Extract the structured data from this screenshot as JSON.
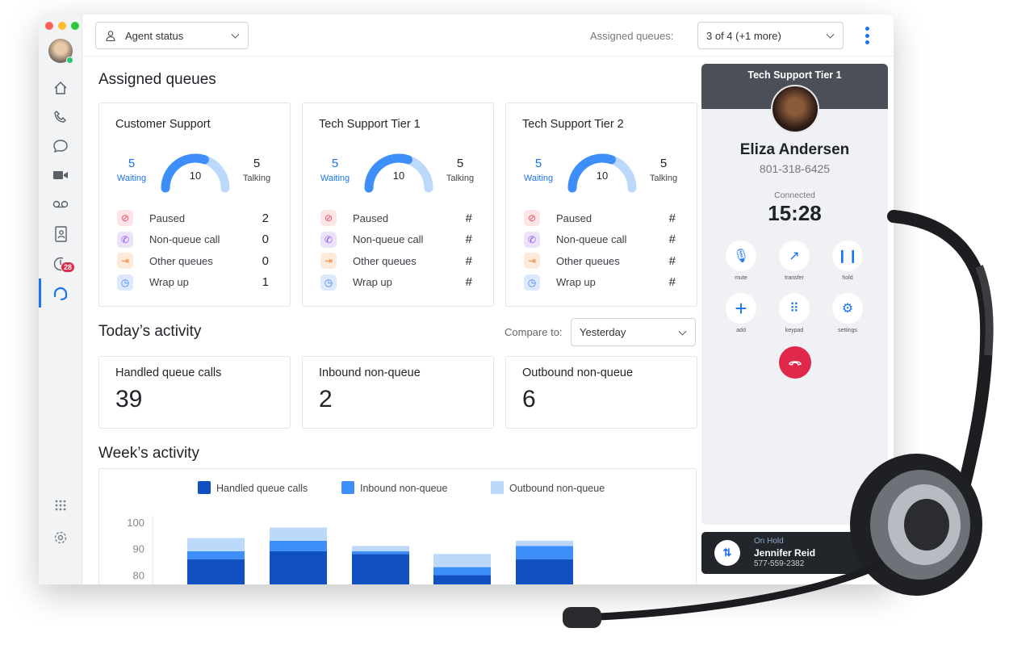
{
  "topbar": {
    "agent_status": "Agent status",
    "assigned_label": "Assigned queues:",
    "assigned_value": "3 of 4 (+1 more)"
  },
  "sidebar": {
    "badge": "28",
    "items": [
      "home",
      "phone",
      "chat",
      "video",
      "voicemail",
      "contacts",
      "history",
      "queues"
    ]
  },
  "assigned": {
    "title": "Assigned queues",
    "queues": [
      {
        "name": "Customer Support",
        "waiting": "5",
        "waiting_label": "Waiting",
        "total": "10",
        "talking": "5",
        "talking_label": "Talking",
        "gauge_fill": 0.6,
        "rows": [
          {
            "label": "Paused",
            "value": "2"
          },
          {
            "label": "Non-queue call",
            "value": "0"
          },
          {
            "label": "Other queues",
            "value": "0"
          },
          {
            "label": "Wrap up",
            "value": "1"
          }
        ]
      },
      {
        "name": "Tech Support Tier 1",
        "waiting": "5",
        "waiting_label": "Waiting",
        "total": "10",
        "talking": "5",
        "talking_label": "Talking",
        "gauge_fill": 0.6,
        "rows": [
          {
            "label": "Paused",
            "value": "#"
          },
          {
            "label": "Non-queue call",
            "value": "#"
          },
          {
            "label": "Other queues",
            "value": "#"
          },
          {
            "label": "Wrap up",
            "value": "#"
          }
        ]
      },
      {
        "name": "Tech Support Tier 2",
        "waiting": "5",
        "waiting_label": "Waiting",
        "total": "10",
        "talking": "5",
        "talking_label": "Talking",
        "gauge_fill": 0.6,
        "rows": [
          {
            "label": "Paused",
            "value": "#"
          },
          {
            "label": "Non-queue call",
            "value": "#"
          },
          {
            "label": "Other queues",
            "value": "#"
          },
          {
            "label": "Wrap up",
            "value": "#"
          }
        ]
      }
    ]
  },
  "today": {
    "title": "Today’s activity",
    "compare_label": "Compare to:",
    "compare_value": "Yesterday",
    "cards": [
      {
        "label": "Handled queue calls",
        "value": "39"
      },
      {
        "label": "Inbound non-queue",
        "value": "2"
      },
      {
        "label": "Outbound non-queue",
        "value": "6"
      }
    ]
  },
  "week": {
    "title": "Week’s activity"
  },
  "chart_data": {
    "type": "bar",
    "stacked": true,
    "legend_position": "top",
    "yticks": [
      "100",
      "90",
      "80"
    ],
    "series": [
      {
        "name": "Handled queue calls",
        "color": "#1150c0",
        "values": [
          86,
          89,
          88,
          80,
          86
        ]
      },
      {
        "name": "Inbound non-queue",
        "color": "#3d8ef8",
        "values": [
          3,
          4,
          1,
          3,
          5
        ]
      },
      {
        "name": "Outbound non-queue",
        "color": "#bcd8fb",
        "values": [
          5,
          5,
          2,
          5,
          2
        ]
      }
    ]
  },
  "call": {
    "queue": "Tech Support Tier 1",
    "name": "Eliza Andersen",
    "number": "801-318-6425",
    "status": "Connected",
    "timer": "15:28",
    "buttons": [
      "mute",
      "transfer",
      "hold",
      "add",
      "keypad",
      "settings"
    ]
  },
  "hold": {
    "status": "On Hold",
    "name": "Jennifer Reid",
    "number": "577-559-2382"
  },
  "colors": {
    "accent": "#1a73f0",
    "end_call": "#e0284a"
  }
}
